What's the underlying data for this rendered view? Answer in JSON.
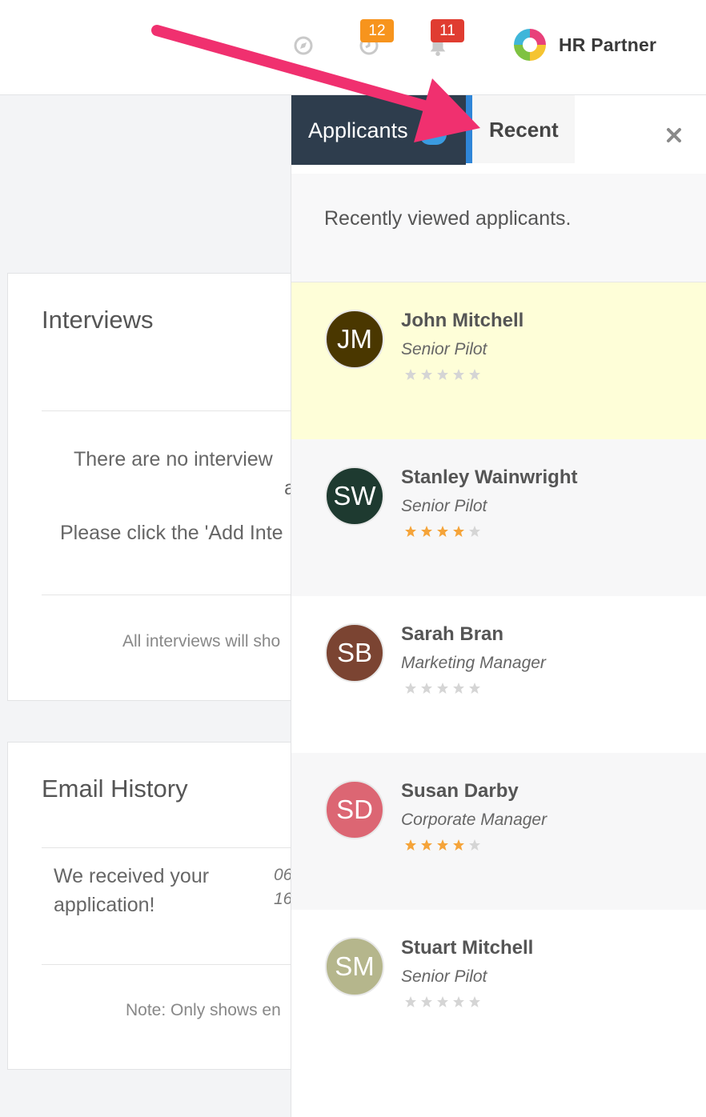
{
  "header": {
    "badges": {
      "timer_count": "12",
      "notifications_count": "11"
    },
    "brand": "HR Partner",
    "icons": [
      "compass-icon",
      "clock-icon",
      "bell-icon",
      "hr-partner-logo-icon"
    ],
    "badge_colors": {
      "timer": "#f7941d",
      "notifications": "#e03c31"
    }
  },
  "background": {
    "interviews": {
      "title": "Interviews",
      "empty_line1": "There are no interview",
      "empty_line1b": "a",
      "empty_line2": "Please click the 'Add Inte",
      "note": "All interviews will sho"
    },
    "email_history": {
      "title": "Email History",
      "entry_line1": "We received your",
      "entry_line2": "application!",
      "entry_date1": "06",
      "entry_date2": "16",
      "note": "Note: Only shows en"
    }
  },
  "panel": {
    "tabs": {
      "applicants": "Applicants",
      "recent": "Recent"
    },
    "subtitle": "Recently viewed applicants.",
    "accent": "#2f86d8",
    "applicants": [
      {
        "initials": "JM",
        "name": "John Mitchell",
        "role": "Senior Pilot",
        "rating": 0,
        "color": "#4a3700",
        "highlight": true
      },
      {
        "initials": "SW",
        "name": "Stanley Wainwright",
        "role": "Senior Pilot",
        "rating": 4,
        "color": "#1e3a30",
        "highlight": false
      },
      {
        "initials": "SB",
        "name": "Sarah Bran",
        "role": "Marketing Manager",
        "rating": 0,
        "color": "#7b4432",
        "highlight": false
      },
      {
        "initials": "SD",
        "name": "Susan Darby",
        "role": "Corporate Manager",
        "rating": 4,
        "color": "#dc6673",
        "highlight": false
      },
      {
        "initials": "SM",
        "name": "Stuart Mitchell",
        "role": "Senior Pilot",
        "rating": 0,
        "color": "#b5b68c",
        "highlight": false
      }
    ]
  }
}
